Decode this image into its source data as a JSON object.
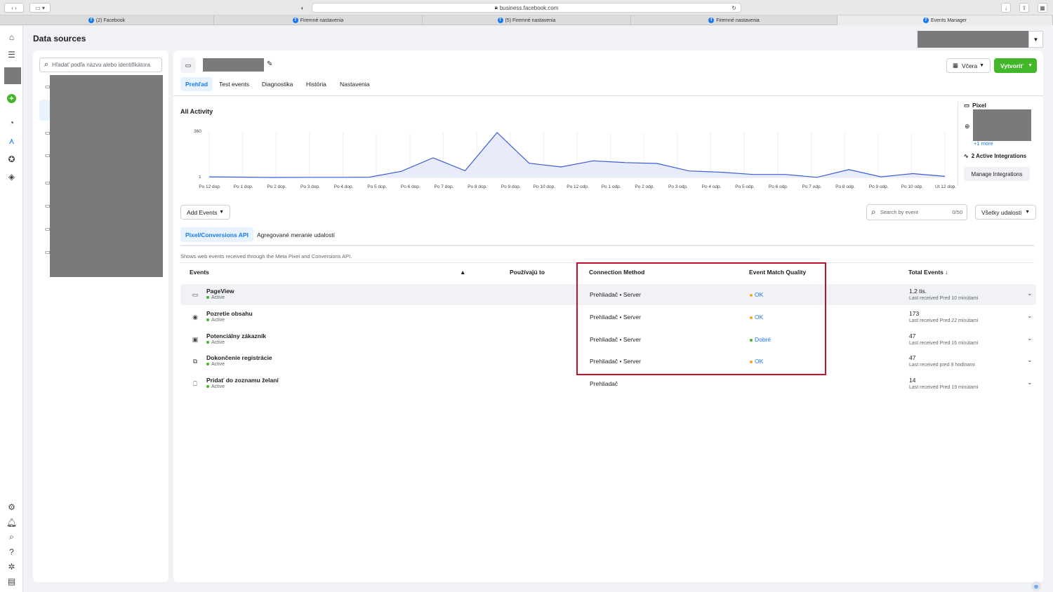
{
  "browser": {
    "url": "business.facebook.com",
    "tabs": [
      {
        "label": "(2) Facebook",
        "active": false
      },
      {
        "label": "Firemné nastavenia",
        "active": false
      },
      {
        "label": "(5) Firemné nastavenia",
        "active": false
      },
      {
        "label": "Firemné nastavenia",
        "active": false
      },
      {
        "label": "Events Manager",
        "active": true
      }
    ]
  },
  "page": {
    "title": "Data sources",
    "search_placeholder": "Hľadať podľa názvu alebo identifikátora",
    "date_label": "Včera",
    "create_label": "Vytvoriť",
    "tabs": [
      "Prehľad",
      "Test events",
      "Diagnostika",
      "História",
      "Nastavenia"
    ]
  },
  "activity": {
    "title": "All Activity",
    "y_max_label": "360",
    "y_min_label": "1"
  },
  "chart_data": {
    "type": "area",
    "title": "All Activity",
    "categories": [
      "Po 12 dop.",
      "Po 1 dop.",
      "Po 2 dop.",
      "Po 3 dop.",
      "Po 4 dop.",
      "Po 5 dop.",
      "Po 6 dop.",
      "Po 7 dop.",
      "Po 8 dop.",
      "Po 9 dop.",
      "Po 10 dop.",
      "Po 12 odp.",
      "Po 1 odp.",
      "Po 2 odp.",
      "Po 3 odp.",
      "Po 4 odp.",
      "Po 5 odp.",
      "Po 6 odp.",
      "Po 7 odp.",
      "Po 8 odp.",
      "Po 9 odp.",
      "Po 10 odp.",
      "Ut 12 dop."
    ],
    "values": [
      6,
      4,
      1,
      2,
      2,
      3,
      50,
      158,
      55,
      360,
      115,
      85,
      134,
      120,
      113,
      53,
      43,
      25,
      25,
      2,
      64,
      6,
      32,
      10
    ],
    "ylim": [
      1,
      360
    ],
    "grid": true
  },
  "integrations": {
    "pixel_label": "Pixel",
    "more_label": "+1 more",
    "active_label": "2 Active Integrations",
    "manage_label": "Manage Integrations"
  },
  "events_toolbar": {
    "add_events_label": "Add Events",
    "search_placeholder": "Search by event",
    "search_count": "0/50",
    "filter_label": "Všetky udalosti",
    "subtabs": [
      "Pixel/Conversions API",
      "Agregované meranie udalostí"
    ],
    "description": "Shows web events received through the Meta Pixel and Conversions API."
  },
  "table": {
    "headers": {
      "events": "Events",
      "used_by": "Používajú to",
      "connection": "Connection Method",
      "emq": "Event Match Quality",
      "total": "Total Events ↓"
    },
    "rows": [
      {
        "icon": "page-icon",
        "name": "PageView",
        "status": "Active",
        "connection": "Prehliadač • Server",
        "emq": "OK",
        "emq_color": "#f5a623",
        "total": "1,2 tis.",
        "last": "Last received Pred 10 minútami"
      },
      {
        "icon": "eye-icon",
        "name": "Pozretie obsahu",
        "status": "Active",
        "connection": "Prehliadač • Server",
        "emq": "OK",
        "emq_color": "#f5a623",
        "total": "173",
        "last": "Last received Pred 22 minútami"
      },
      {
        "icon": "contact-card-icon",
        "name": "Potenciálny zákazník",
        "status": "Active",
        "connection": "Prehliadač • Server",
        "emq": "Dobré",
        "emq_color": "#42b72a",
        "total": "47",
        "last": "Last received Pred 16 minútami"
      },
      {
        "icon": "registration-icon",
        "name": "Dokončenie registrácie",
        "status": "Active",
        "connection": "Prehliadač • Server",
        "emq": "OK",
        "emq_color": "#f5a623",
        "total": "47",
        "last": "Last received pred 9 hodinami"
      },
      {
        "icon": "bookmark-icon",
        "name": "Pridať do zoznamu želaní",
        "status": "Active",
        "connection": "Prehliadač",
        "emq": "",
        "emq_color": "",
        "total": "14",
        "last": "Last received Pred 19 minútami"
      }
    ]
  },
  "colors": {
    "accent": "#1877f2",
    "create_green": "#42b72a",
    "highlight_border": "#c8102e",
    "active_dot": "#42b72a"
  }
}
